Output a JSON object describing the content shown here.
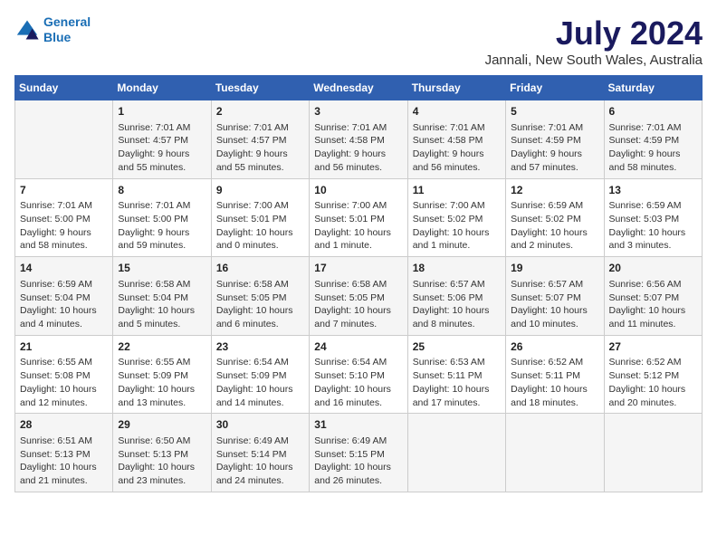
{
  "logo": {
    "line1": "General",
    "line2": "Blue"
  },
  "title": "July 2024",
  "subtitle": "Jannali, New South Wales, Australia",
  "days_of_week": [
    "Sunday",
    "Monday",
    "Tuesday",
    "Wednesday",
    "Thursday",
    "Friday",
    "Saturday"
  ],
  "weeks": [
    [
      {
        "day": "",
        "content": ""
      },
      {
        "day": "1",
        "content": "Sunrise: 7:01 AM\nSunset: 4:57 PM\nDaylight: 9 hours\nand 55 minutes."
      },
      {
        "day": "2",
        "content": "Sunrise: 7:01 AM\nSunset: 4:57 PM\nDaylight: 9 hours\nand 55 minutes."
      },
      {
        "day": "3",
        "content": "Sunrise: 7:01 AM\nSunset: 4:58 PM\nDaylight: 9 hours\nand 56 minutes."
      },
      {
        "day": "4",
        "content": "Sunrise: 7:01 AM\nSunset: 4:58 PM\nDaylight: 9 hours\nand 56 minutes."
      },
      {
        "day": "5",
        "content": "Sunrise: 7:01 AM\nSunset: 4:59 PM\nDaylight: 9 hours\nand 57 minutes."
      },
      {
        "day": "6",
        "content": "Sunrise: 7:01 AM\nSunset: 4:59 PM\nDaylight: 9 hours\nand 58 minutes."
      }
    ],
    [
      {
        "day": "7",
        "content": "Sunrise: 7:01 AM\nSunset: 5:00 PM\nDaylight: 9 hours\nand 58 minutes."
      },
      {
        "day": "8",
        "content": "Sunrise: 7:01 AM\nSunset: 5:00 PM\nDaylight: 9 hours\nand 59 minutes."
      },
      {
        "day": "9",
        "content": "Sunrise: 7:00 AM\nSunset: 5:01 PM\nDaylight: 10 hours\nand 0 minutes."
      },
      {
        "day": "10",
        "content": "Sunrise: 7:00 AM\nSunset: 5:01 PM\nDaylight: 10 hours\nand 1 minute."
      },
      {
        "day": "11",
        "content": "Sunrise: 7:00 AM\nSunset: 5:02 PM\nDaylight: 10 hours\nand 1 minute."
      },
      {
        "day": "12",
        "content": "Sunrise: 6:59 AM\nSunset: 5:02 PM\nDaylight: 10 hours\nand 2 minutes."
      },
      {
        "day": "13",
        "content": "Sunrise: 6:59 AM\nSunset: 5:03 PM\nDaylight: 10 hours\nand 3 minutes."
      }
    ],
    [
      {
        "day": "14",
        "content": "Sunrise: 6:59 AM\nSunset: 5:04 PM\nDaylight: 10 hours\nand 4 minutes."
      },
      {
        "day": "15",
        "content": "Sunrise: 6:58 AM\nSunset: 5:04 PM\nDaylight: 10 hours\nand 5 minutes."
      },
      {
        "day": "16",
        "content": "Sunrise: 6:58 AM\nSunset: 5:05 PM\nDaylight: 10 hours\nand 6 minutes."
      },
      {
        "day": "17",
        "content": "Sunrise: 6:58 AM\nSunset: 5:05 PM\nDaylight: 10 hours\nand 7 minutes."
      },
      {
        "day": "18",
        "content": "Sunrise: 6:57 AM\nSunset: 5:06 PM\nDaylight: 10 hours\nand 8 minutes."
      },
      {
        "day": "19",
        "content": "Sunrise: 6:57 AM\nSunset: 5:07 PM\nDaylight: 10 hours\nand 10 minutes."
      },
      {
        "day": "20",
        "content": "Sunrise: 6:56 AM\nSunset: 5:07 PM\nDaylight: 10 hours\nand 11 minutes."
      }
    ],
    [
      {
        "day": "21",
        "content": "Sunrise: 6:55 AM\nSunset: 5:08 PM\nDaylight: 10 hours\nand 12 minutes."
      },
      {
        "day": "22",
        "content": "Sunrise: 6:55 AM\nSunset: 5:09 PM\nDaylight: 10 hours\nand 13 minutes."
      },
      {
        "day": "23",
        "content": "Sunrise: 6:54 AM\nSunset: 5:09 PM\nDaylight: 10 hours\nand 14 minutes."
      },
      {
        "day": "24",
        "content": "Sunrise: 6:54 AM\nSunset: 5:10 PM\nDaylight: 10 hours\nand 16 minutes."
      },
      {
        "day": "25",
        "content": "Sunrise: 6:53 AM\nSunset: 5:11 PM\nDaylight: 10 hours\nand 17 minutes."
      },
      {
        "day": "26",
        "content": "Sunrise: 6:52 AM\nSunset: 5:11 PM\nDaylight: 10 hours\nand 18 minutes."
      },
      {
        "day": "27",
        "content": "Sunrise: 6:52 AM\nSunset: 5:12 PM\nDaylight: 10 hours\nand 20 minutes."
      }
    ],
    [
      {
        "day": "28",
        "content": "Sunrise: 6:51 AM\nSunset: 5:13 PM\nDaylight: 10 hours\nand 21 minutes."
      },
      {
        "day": "29",
        "content": "Sunrise: 6:50 AM\nSunset: 5:13 PM\nDaylight: 10 hours\nand 23 minutes."
      },
      {
        "day": "30",
        "content": "Sunrise: 6:49 AM\nSunset: 5:14 PM\nDaylight: 10 hours\nand 24 minutes."
      },
      {
        "day": "31",
        "content": "Sunrise: 6:49 AM\nSunset: 5:15 PM\nDaylight: 10 hours\nand 26 minutes."
      },
      {
        "day": "",
        "content": ""
      },
      {
        "day": "",
        "content": ""
      },
      {
        "day": "",
        "content": ""
      }
    ]
  ]
}
